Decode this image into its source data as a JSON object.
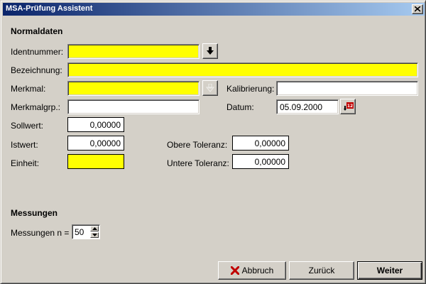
{
  "window": {
    "title": "MSA-Prüfung Assistent"
  },
  "normaldaten": {
    "heading": "Normaldaten",
    "identnummer": {
      "label": "Identnummer:",
      "value": ""
    },
    "bezeichnung": {
      "label": "Bezeichnung:",
      "value": ""
    },
    "merkmal": {
      "label": "Merkmal:",
      "value": ""
    },
    "kalibrierung": {
      "label": "Kalibrierung:",
      "value": ""
    },
    "merkmalgrp": {
      "label": "Merkmalgrp.:",
      "value": ""
    },
    "datum": {
      "label": "Datum:",
      "value": "05.09.2000",
      "calendar_icon_text": "12"
    },
    "sollwert": {
      "label": "Sollwert:",
      "value": "0,00000"
    },
    "istwert": {
      "label": "Istwert:",
      "value": "0,00000"
    },
    "obere_toleranz": {
      "label": "Obere Toleranz:",
      "value": "0,00000"
    },
    "einheit": {
      "label": "Einheit:",
      "value": ""
    },
    "untere_toleranz": {
      "label": "Untere Toleranz:",
      "value": "0,00000"
    }
  },
  "messungen": {
    "heading": "Messungen",
    "n_label": "Messungen n =",
    "n_value": "50"
  },
  "buttons": {
    "abbruch": "Abbruch",
    "zurueck": "Zurück",
    "weiter": "Weiter"
  },
  "colors": {
    "required_field": "#ffff00",
    "title_gradient_start": "#0a246a",
    "title_gradient_end": "#a6caf0",
    "cancel_icon": "#c00000"
  },
  "icons": {
    "identnummer_lookup": "arrow-down-icon",
    "merkmal_lookup": "arrow-down-icon",
    "datum_picker": "calendar-icon",
    "close": "close-icon",
    "abbruch": "x-icon"
  }
}
